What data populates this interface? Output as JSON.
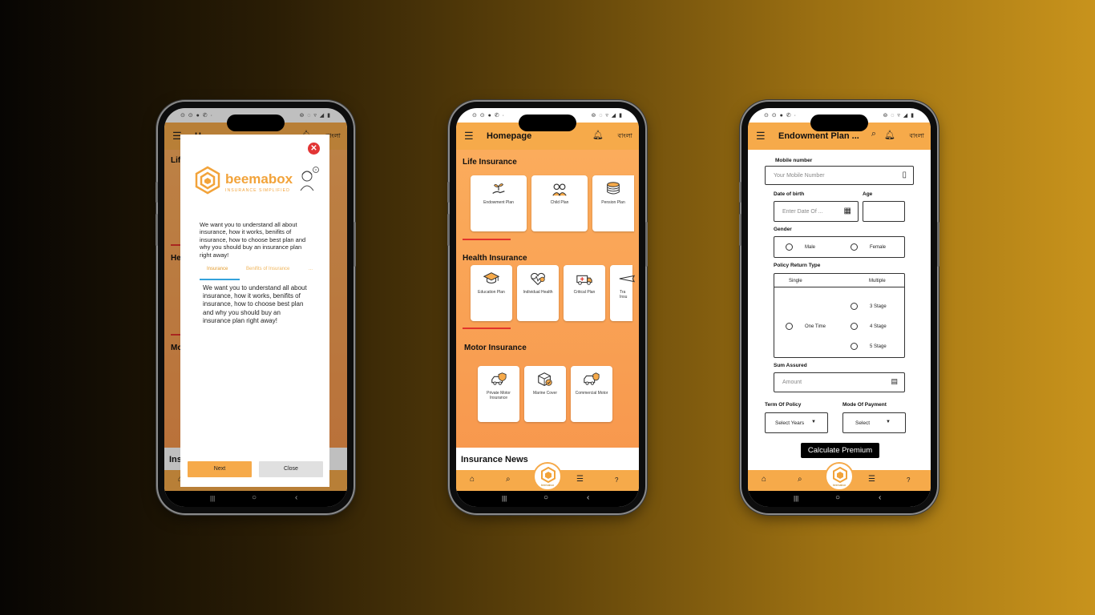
{
  "status": {
    "left_icons": "⊙ ⊙ ● ✆ ·",
    "right_icons": "⊚ ◌ ▿ ◢ ▮"
  },
  "phone1": {
    "title_partial": "H",
    "lang": "বাংলা",
    "behind_sections": [
      "Life",
      "Hea",
      "Mo",
      "Ins"
    ],
    "dialog": {
      "brand_name": "beemabox",
      "brand_tagline": "INSURANCE SIMPLIFIED",
      "intro_text": "We want you to understand all about insurance, how it works, benifits of insurance, how to choose best plan and why you should buy an insurance plan right away!",
      "tabs": [
        "Insurance",
        "Benifits of Insurance",
        "..."
      ],
      "tab_body": "We want you to understand all about insurance, how it works, benifits of insurance, how to choose best plan and why you should buy an insurance plan right away!",
      "next_label": "Next",
      "close_label": "Close"
    }
  },
  "phone2": {
    "title": "Homepage",
    "lang": "বাংলা",
    "life": {
      "heading": "Life Insurance",
      "cards": [
        {
          "label": "Endowment Plan",
          "icon": "plant-hand-icon"
        },
        {
          "label": "Child Plan",
          "icon": "children-icon"
        },
        {
          "label": "Pension Plan",
          "icon": "coins-icon"
        }
      ]
    },
    "health": {
      "heading": "Health Insurance",
      "cards": [
        {
          "label": "Education Plan",
          "icon": "graduation-cap-icon"
        },
        {
          "label": "Individual Health",
          "icon": "heart-pulse-icon"
        },
        {
          "label": "Critical Plan",
          "icon": "ambulance-icon"
        },
        {
          "label": "Tra Insu",
          "icon": "plane-icon"
        }
      ]
    },
    "motor": {
      "heading": "Motor Insurance",
      "cards": [
        {
          "label": "Private Motor Insurance",
          "icon": "car-shield-icon"
        },
        {
          "label": "Marine Cover",
          "icon": "box-check-icon"
        },
        {
          "label": "Commercial Motor",
          "icon": "truck-shield-icon"
        }
      ]
    },
    "news_heading": "Insurance News"
  },
  "phone3": {
    "title": "Endowment Plan ...",
    "lang": "বাংলা",
    "mobile_label": "Mobile number",
    "mobile_placeholder": "Your Mobile Number",
    "dob_label": "Date of birth",
    "dob_placeholder": "Enter Date Of ...",
    "age_label": "Age",
    "gender_label": "Gender",
    "gender_options": [
      "Male",
      "Female"
    ],
    "return_label": "Policy Return Type",
    "return_cols": [
      "Single",
      "Multiple"
    ],
    "single_option": "One Time",
    "multiple_options": [
      "3 Stage",
      "4 Stage",
      "5 Stage"
    ],
    "sum_label": "Sum Assured",
    "sum_placeholder": "Amount",
    "term_label": "Term Of Policy",
    "term_value": "Select Years",
    "mode_label": "Mode Of Payment",
    "mode_value": "Select",
    "calc_label": "Calculate Premium"
  },
  "fab_text": "beemabox",
  "nav": {
    "home": "⌂",
    "search": "⌕",
    "list": "☰",
    "help": "?"
  },
  "sysnav": {
    "recent": "|||",
    "home": "○",
    "back": "‹"
  },
  "colors": {
    "accent": "#f6aa4a",
    "orange_bg": "#f7974d",
    "red": "#e2342b",
    "brand_text": "#f2a33a"
  }
}
